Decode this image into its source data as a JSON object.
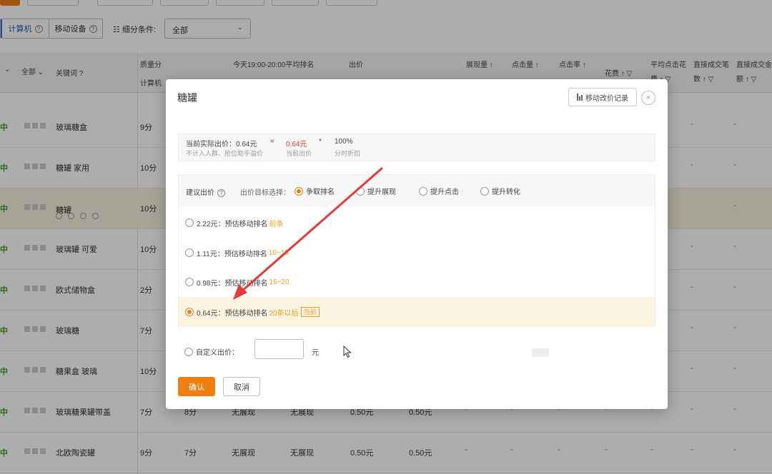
{
  "background": {
    "device_tabs": [
      {
        "label": "计算机"
      },
      {
        "label": "移动设备"
      }
    ],
    "filter": {
      "label": "细分条件:",
      "value": "全部"
    },
    "headers": {
      "status": "全部",
      "keyword": "关键词 ?",
      "quality": "质量分",
      "quality_sub": "计算机",
      "rank": "今天19:00-20:00平均排名",
      "bid": "出价",
      "impressions": "展现量 ↑",
      "clicks": "点击量 ↑",
      "ctr": "点击率 ↑",
      "cost": "花费 ↑ ▽",
      "avg_cpc": "平均点击花",
      "direct_deals": "直接成交笔",
      "direct_amount": "直接成交金",
      "avg_cpc_sub": "费 ↑ ▽",
      "direct_deals_sub": "数 ↑ ▽",
      "direct_amount_sub": "额 ↑ ▽"
    },
    "rows": [
      {
        "status": "中",
        "keyword": "玻璃糖盒",
        "score": "9分"
      },
      {
        "status": "中",
        "keyword": "糖罐 家用",
        "score": "10分"
      },
      {
        "status": "中",
        "keyword": "糖罐",
        "score": "10分"
      },
      {
        "status": "中",
        "keyword": "玻璃罐 可爱",
        "score": "10分"
      },
      {
        "status": "中",
        "keyword": "欧式储物盒",
        "score": "2分"
      },
      {
        "status": "中",
        "keyword": "玻璃糖",
        "score": "7分"
      },
      {
        "status": "中",
        "keyword": "糖果盒 玻璃",
        "score": "10分"
      },
      {
        "status": "中",
        "keyword": "玻璃糖果罐带盖",
        "score": "7分",
        "m_score": "8分",
        "rank1": "无展现",
        "rank2": "无展现",
        "bid1": "0.50元",
        "bid2": "0.50元"
      },
      {
        "status": "中",
        "keyword": "北欧陶瓷罐",
        "score": "9分",
        "m_score": "7分",
        "rank1": "无展现",
        "rank2": "无展现",
        "bid1": "0.50元",
        "bid2": "0.50元"
      }
    ],
    "dash": "-"
  },
  "modal": {
    "title": "糖罐",
    "history_button": "移动改价记录",
    "close": "×",
    "info": {
      "actual_label": "当前实际出价：0.64元",
      "equals": "=",
      "current_value": "0.64元",
      "times": "*",
      "percent": "100%",
      "note": "不计入人群、抢位助手溢价",
      "current_label": "当前出价",
      "discount_label": "分时折扣"
    },
    "suggest": {
      "label": "建议出价",
      "goal_label": "出价目标选择：",
      "goals": [
        "争取排名",
        "提升展现",
        "提升点击",
        "提升转化"
      ]
    },
    "options": [
      {
        "price": "2.22元：",
        "desc": "预估移动排名",
        "rank": "前条"
      },
      {
        "price": "1.11元：",
        "desc": "预估移动排名",
        "rank": "10~15"
      },
      {
        "price": "0.98元：",
        "desc": "预估移动排名",
        "rank": "16~20"
      },
      {
        "price": "0.64元：",
        "desc": "预估移动排名",
        "rank": "20条以后",
        "tag": "当前"
      }
    ],
    "custom_label": "自定义出价：",
    "custom_value": "",
    "unit": "元",
    "confirm": "确认",
    "cancel": "取消"
  },
  "colors": {
    "accent": "#f07f10",
    "price_red": "#e03a2e",
    "rank_orange": "#f0a020"
  }
}
